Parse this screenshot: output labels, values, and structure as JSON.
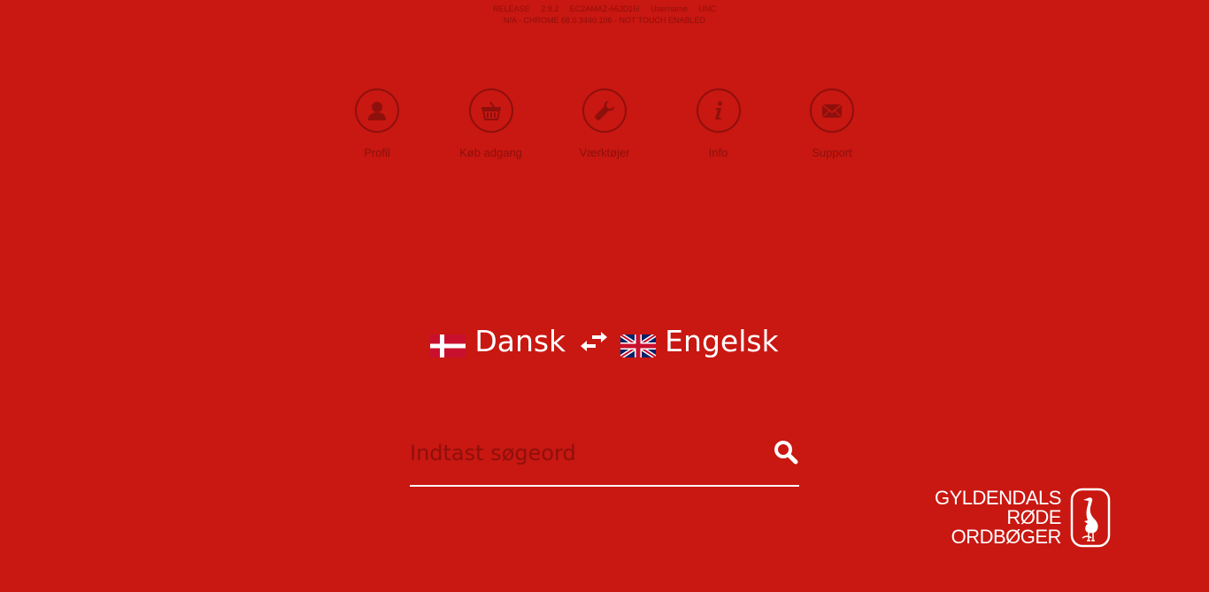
{
  "debug": {
    "release": "RELEASE",
    "version": "2.9.2",
    "server": "EC2AMAZ-66JD16I",
    "username": "Username",
    "unc": "UNC",
    "browser": "N/A - CHROME 68.0.3440.106 - NOT TOUCH ENABLED"
  },
  "nav": {
    "items": [
      {
        "label": "Profil",
        "icon": "user-icon"
      },
      {
        "label": "Køb adgang",
        "icon": "basket-icon"
      },
      {
        "label": "Værktøjer",
        "icon": "wrench-icon"
      },
      {
        "label": "Info",
        "icon": "info-icon"
      },
      {
        "label": "Support",
        "icon": "envelope-icon"
      }
    ]
  },
  "language": {
    "source": "Dansk",
    "target": "Engelsk",
    "source_flag": "danish-flag-icon",
    "target_flag": "uk-flag-icon",
    "swap_icon": "swap-arrows-icon"
  },
  "search": {
    "placeholder": "Indtast søgeord",
    "value": "",
    "icon": "search-icon"
  },
  "logo": {
    "line1": "GYLDENDALS",
    "line2": "RØDE",
    "line3": "ORDBØGER",
    "icon": "heron-logo-icon"
  },
  "colors": {
    "background": "#c91711",
    "muted": "#8e100c",
    "foreground": "#ffffff"
  }
}
